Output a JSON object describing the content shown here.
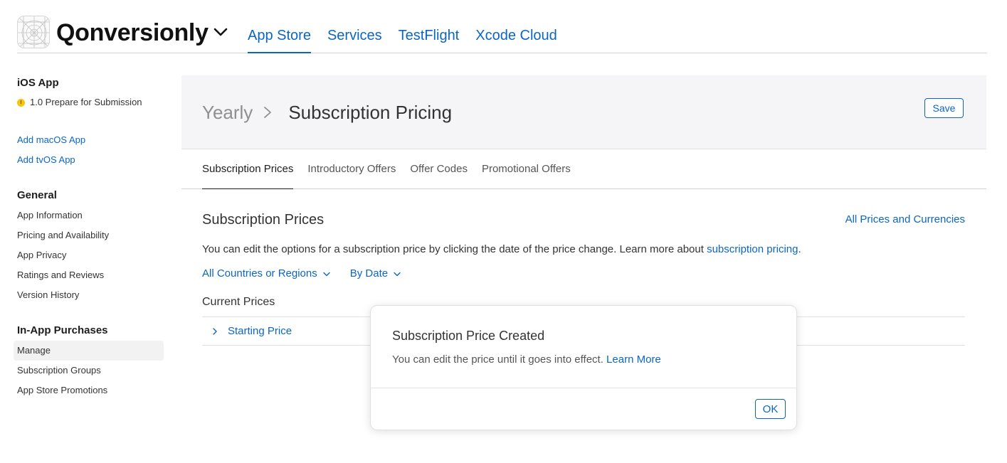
{
  "header": {
    "app_name": "Qonversionly",
    "nav": [
      {
        "label": "App Store",
        "active": true
      },
      {
        "label": "Services",
        "active": false
      },
      {
        "label": "TestFlight",
        "active": false
      },
      {
        "label": "Xcode Cloud",
        "active": false
      }
    ]
  },
  "sidebar": {
    "platform_title": "iOS App",
    "version_status": "1.0 Prepare for Submission",
    "add_links": [
      "Add macOS App",
      "Add tvOS App"
    ],
    "general": {
      "title": "General",
      "items": [
        "App Information",
        "Pricing and Availability",
        "App Privacy",
        "Ratings and Reviews",
        "Version History"
      ]
    },
    "iap": {
      "title": "In-App Purchases",
      "items": [
        "Manage",
        "Subscription Groups",
        "App Store Promotions"
      ],
      "selected": "Manage"
    }
  },
  "page": {
    "breadcrumb_parent": "Yearly",
    "breadcrumb_current": "Subscription Pricing",
    "save_label": "Save",
    "tabs": [
      "Subscription Prices",
      "Introductory Offers",
      "Offer Codes",
      "Promotional Offers"
    ],
    "active_tab": "Subscription Prices",
    "section_title": "Subscription Prices",
    "all_prices_link": "All Prices and Currencies",
    "description": "You can edit the options for a subscription price by clicking the date of the price change. Learn more about ",
    "description_link": "subscription pricing",
    "description_end": ".",
    "filter_region": "All Countries or Regions",
    "filter_sort": "By Date",
    "current_prices_title": "Current Prices",
    "row_label": "Starting Price"
  },
  "modal": {
    "title": "Subscription Price Created",
    "body": "You can edit the price until it goes into effect. ",
    "link": "Learn More",
    "ok_label": "OK"
  },
  "colors": {
    "accent": "#0b66c2",
    "status_yellow": "#f6c40b",
    "header_panel": "#f5f5f7"
  }
}
